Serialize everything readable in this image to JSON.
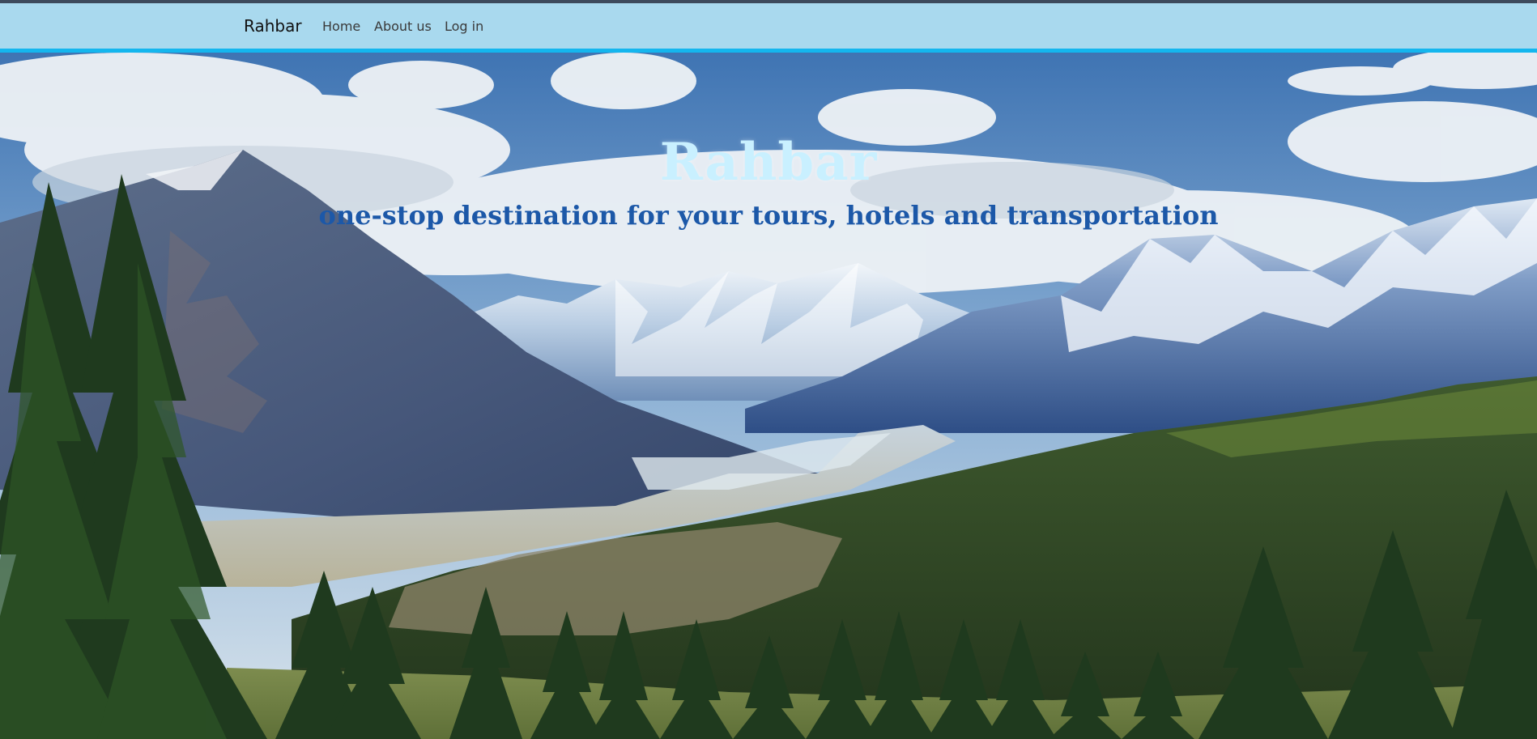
{
  "navbar": {
    "brand": "Rahbar",
    "links": [
      {
        "label": "Home"
      },
      {
        "label": "About us"
      },
      {
        "label": "Log in"
      }
    ]
  },
  "hero": {
    "title": "Rahbar",
    "subtitle": "one-stop destination for your tours, hotels and transportation",
    "background": "mountain-valley-landscape"
  },
  "colors": {
    "navbar_bg": "#a9d9ee",
    "navbar_border": "#14b6ee",
    "title": "#c9f0ff",
    "subtitle": "#1c58a8"
  }
}
